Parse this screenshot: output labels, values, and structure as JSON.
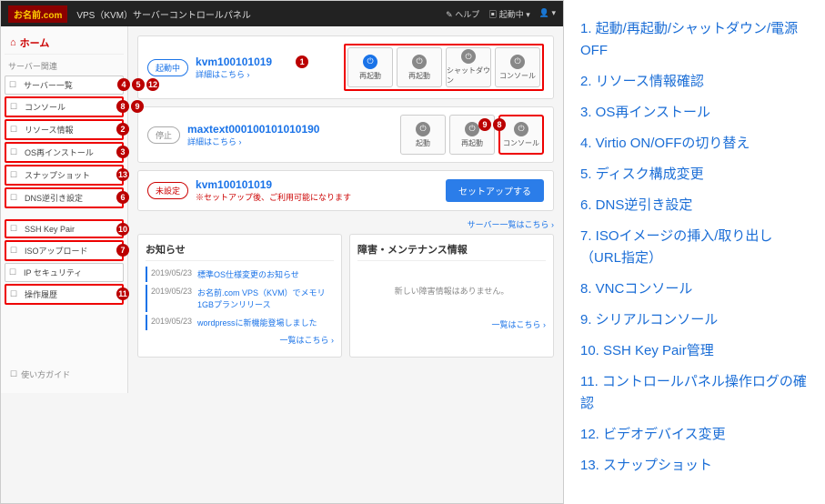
{
  "header": {
    "logo_top": "お名前.com",
    "breadcrumb": "VPS（KVM）サーバーコントロールパネル",
    "help": "ヘルプ",
    "status": "起動中",
    "user_icon": "▾"
  },
  "sidebar": {
    "home": "ホーム",
    "section": "サーバー関連",
    "items": [
      {
        "label": "サーバー一覧",
        "badges": [
          "4",
          "5",
          "12"
        ]
      },
      {
        "label": "コンソール",
        "badges": [
          "8",
          "9"
        ],
        "red": true
      },
      {
        "label": "リソース情報",
        "badges": [
          "2"
        ],
        "red": true
      },
      {
        "label": "OS再インストール",
        "badges": [
          "3"
        ],
        "red": true
      },
      {
        "label": "スナップショット",
        "badges": [
          "13"
        ],
        "red": true
      },
      {
        "label": "DNS逆引き設定",
        "badges": [
          "6"
        ],
        "red": true
      }
    ],
    "items2": [
      {
        "label": "SSH Key Pair",
        "badges": [
          "10"
        ],
        "red": true
      },
      {
        "label": "ISOアップロード",
        "badges": [
          "7"
        ],
        "red": true
      },
      {
        "label": "IP セキュリティ",
        "badges": []
      },
      {
        "label": "操作履歴",
        "badges": [
          "11"
        ],
        "red": true
      }
    ],
    "guide": "使い方ガイド"
  },
  "servers": [
    {
      "name": "kvm100101019",
      "status": "起動中",
      "status_class": "",
      "detail": "詳細はこちら ›",
      "badge": "1",
      "actions": [
        {
          "label": "再起動",
          "t": "blue"
        },
        {
          "label": "再起動"
        },
        {
          "label": "シャットダウン"
        },
        {
          "label": "コンソール"
        }
      ],
      "boxed": true
    },
    {
      "name": "maxtext000100101010190",
      "status": "停止",
      "status_class": "gray",
      "detail": "詳細はこちら ›",
      "actions": [
        {
          "label": "起動"
        },
        {
          "label": "再起動"
        },
        {
          "label": "",
          "hidden": true
        },
        {
          "label": "コンソール",
          "red": true,
          "badges": [
            "8",
            "9"
          ]
        }
      ]
    },
    {
      "name": "kvm100101019",
      "status": "未設定",
      "status_class": "pending",
      "note": "※セットアップ後、ご利用可能になります",
      "setup": "セットアップする"
    }
  ],
  "link_all": "サーバー一覧はこちら ›",
  "news": {
    "title": "お知らせ",
    "items": [
      {
        "date": "2019/05/23",
        "title": "標準OS仕様変更のお知らせ"
      },
      {
        "date": "2019/05/23",
        "title": "お名前.com VPS（KVM）でメモリ1GBプランリリース"
      },
      {
        "date": "2019/05/23",
        "title": "wordpressに新機能登場しました"
      }
    ],
    "more": "一覧はこちら ›"
  },
  "maint": {
    "title": "障害・メンテナンス情報",
    "empty": "新しい障害情報はありません。",
    "more": "一覧はこちら ›"
  },
  "legend": [
    "1.  起動/再起動/シャットダウン/電源OFF",
    "2.  リソース情報確認",
    "3.  OS再インストール",
    "4.  Virtio ON/OFFの切り替え",
    "5.  ディスク構成変更",
    "6.  DNS逆引き設定",
    "7.  ISOイメージの挿入/取り出し（URL指定）",
    "8.  VNCコンソール",
    "9.  シリアルコンソール",
    "10.  SSH Key Pair管理",
    "11.  コントロールパネル操作ログの確認",
    "12.  ビデオデバイス変更",
    "13.  スナップショット"
  ]
}
